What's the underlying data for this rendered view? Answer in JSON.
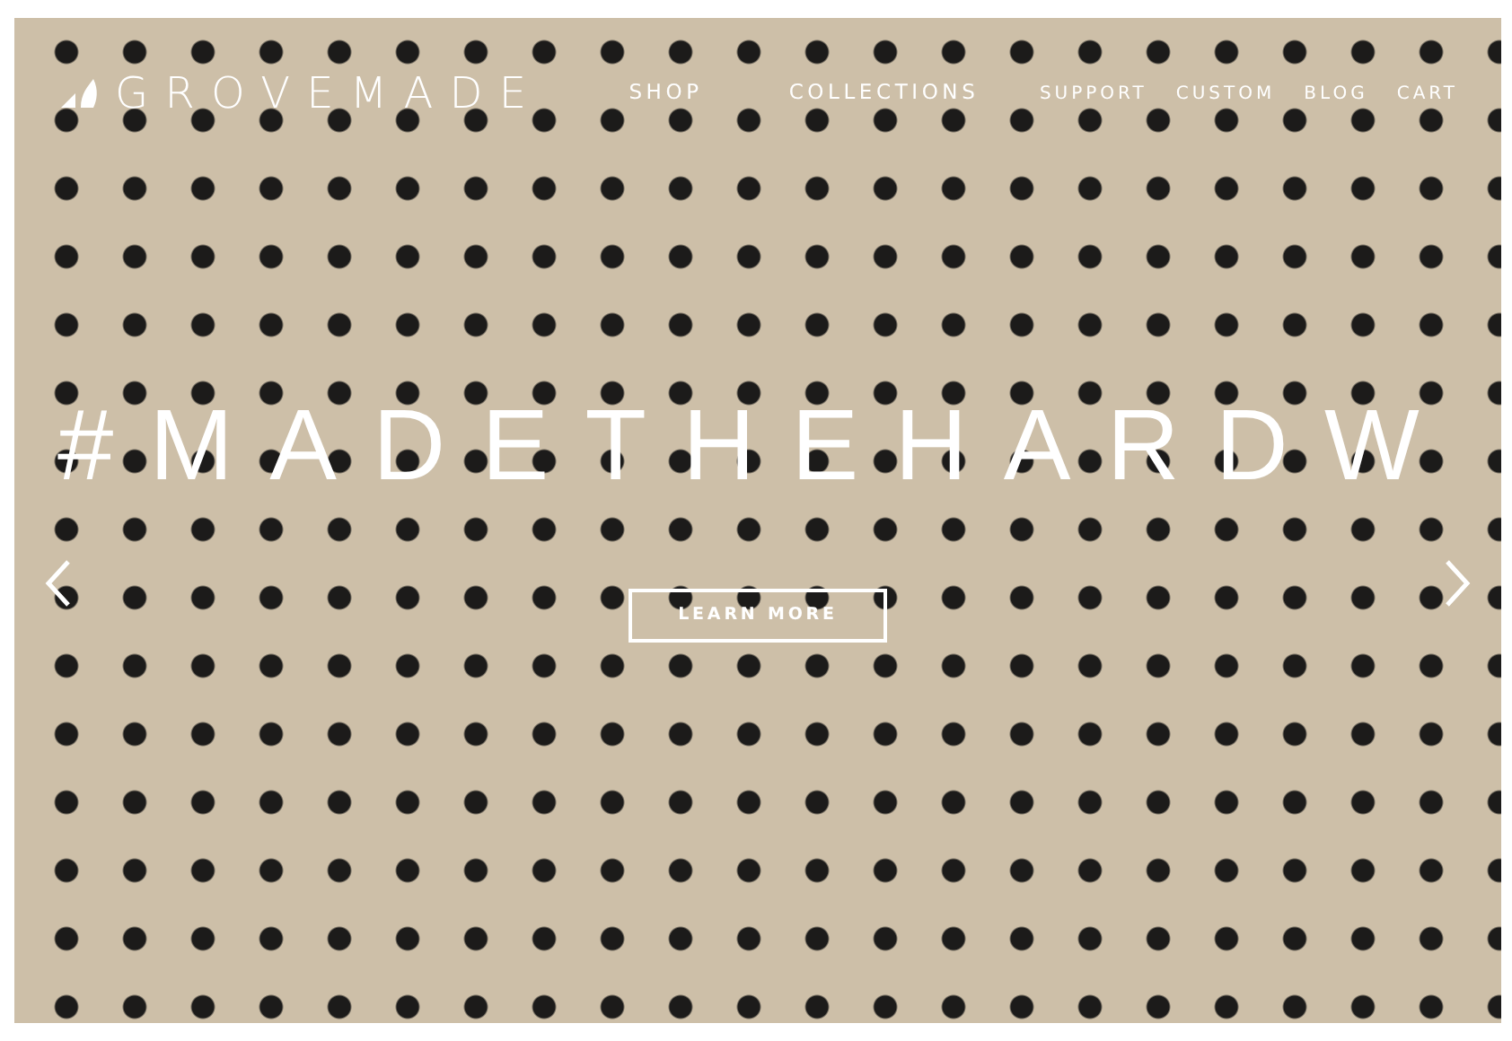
{
  "header": {
    "brand": "GROVEMADE",
    "primary_nav": [
      "SHOP",
      "COLLECTIONS"
    ],
    "secondary_nav": [
      "SUPPORT",
      "CUSTOM",
      "BLOG",
      "CART"
    ]
  },
  "hero": {
    "heading": "#MADETHEHARDW",
    "button": "LEARN MORE"
  }
}
